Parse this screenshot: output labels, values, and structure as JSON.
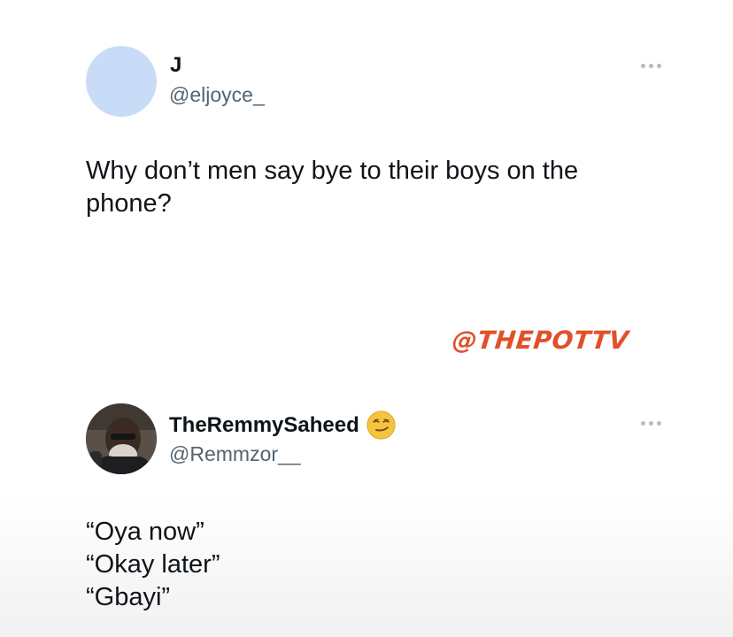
{
  "post1": {
    "display_name": "J",
    "handle": "@eljoyce_",
    "text": "Why don’t men say bye to their boys on the phone?",
    "avatar_color": "#c9dcf7"
  },
  "watermark": "@THEPOTTV",
  "post2": {
    "display_name": "TheRemmySaheed",
    "emoji": "smirking-face",
    "handle": "@Remmzor__",
    "lines": [
      "“Oya now”",
      "“Okay later”",
      "“Gbayi”"
    ]
  },
  "colors": {
    "text": "#0f1419",
    "handle": "#536471",
    "watermark": "#e0502a"
  }
}
